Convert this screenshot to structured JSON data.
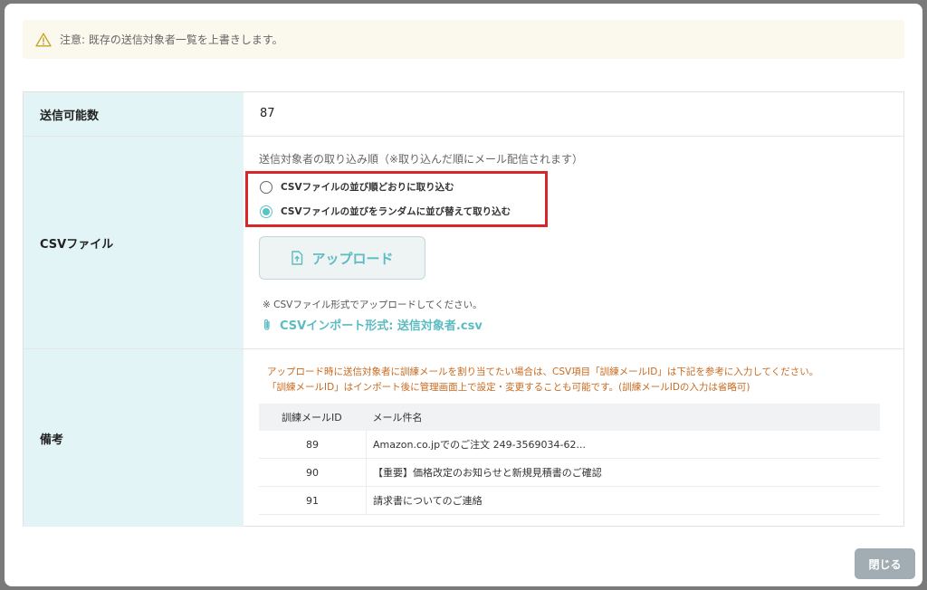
{
  "warning": {
    "icon": "warning-triangle-icon",
    "text": "注意: 既存の送信対象者一覧を上書きします。"
  },
  "fields": {
    "count": {
      "label": "送信可能数",
      "value": "87"
    },
    "csv": {
      "label": "CSVファイル",
      "import_order_title": "送信対象者の取り込み順（※取り込んだ順にメール配信されます）",
      "options": [
        {
          "label": "CSVファイルの並び順どおりに取り込む",
          "checked": false
        },
        {
          "label": "CSVファイルの並びをランダムに並び替えて取り込む",
          "checked": true
        }
      ],
      "upload_label": "アップロード",
      "upload_icon": "file-upload-icon",
      "note": "※ CSVファイル形式でアップロードしてください。",
      "link_icon": "paperclip-icon",
      "link_text": "CSVインポート形式: 送信対象者.csv"
    },
    "notes": {
      "label": "備考",
      "text_line1": "アップロード時に送信対象者に訓練メールを割り当てたい場合は、CSV項目「訓練メールID」は下記を参考に入力してください。",
      "text_line2": "「訓練メールID」はインポート後に管理画面上で設定・変更することも可能です。(訓練メールIDの入力は省略可)",
      "columns": [
        "訓練メールID",
        "メール件名"
      ],
      "rows": [
        {
          "id": "89",
          "subject": "Amazon.co.jpでのご注文 249-3569034-62..."
        },
        {
          "id": "90",
          "subject": "【重要】価格改定のお知らせと新規見積書のご確認"
        },
        {
          "id": "91",
          "subject": "請求書についてのご連絡"
        }
      ]
    }
  },
  "close_label": "閉じる",
  "colors": {
    "accent": "#5cc2c8",
    "highlight_border": "#d9262b",
    "note_text": "#c96a1f",
    "label_bg": "#e3f4f6"
  }
}
